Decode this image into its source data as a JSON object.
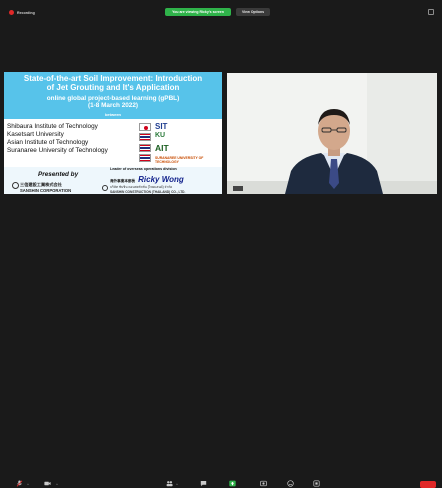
{
  "meeting": {
    "recording_label": "Recording",
    "viewing_label": "You are viewing Ricky's screen",
    "view_options_label": "View Options"
  },
  "slide": {
    "title_line1": "State-of-the-art Soil Improvement: Introduction",
    "title_line2": "of Jet Grouting and It's Application",
    "subtitle_line1": "online global project-based learning (gPBL)",
    "subtitle_line2": "(1-8 March 2022)",
    "between": "between",
    "universities": [
      "Shibaura Institute of Technology",
      "Kasetsart University",
      "Asian Institute of Technology",
      "Suranaree University of Technology"
    ],
    "logos": {
      "sit": "SIT",
      "ku": "KU",
      "ait": "AIT",
      "sut": "SURANAREE UNIVERSITY OF TECHNOLOGY"
    },
    "presented_by": "Presented by",
    "company_jp": "三信建設工業株式会社",
    "company_en": "SANSHIN CORPORATION",
    "leader_line1": "Leader of overseas operations division",
    "leader_kanji": "海外事業本部長",
    "leader_name": "Ricky Wong",
    "leader_name_thai": "บริษัท ซันชิน คอนสตรัคชั่น (ไทยแลนด์) จำกัด",
    "sanshin_thailand": "SANSHIN CONSTRUCTION (THAILAND) CO., LTD."
  },
  "toolbar": {
    "caret": "^"
  },
  "colors": {
    "banner": "#57c3ea",
    "name": "#0e1e8a",
    "viewing_pill": "#2fb34a",
    "end_button": "#e02828",
    "share_green": "#2fb34a"
  }
}
